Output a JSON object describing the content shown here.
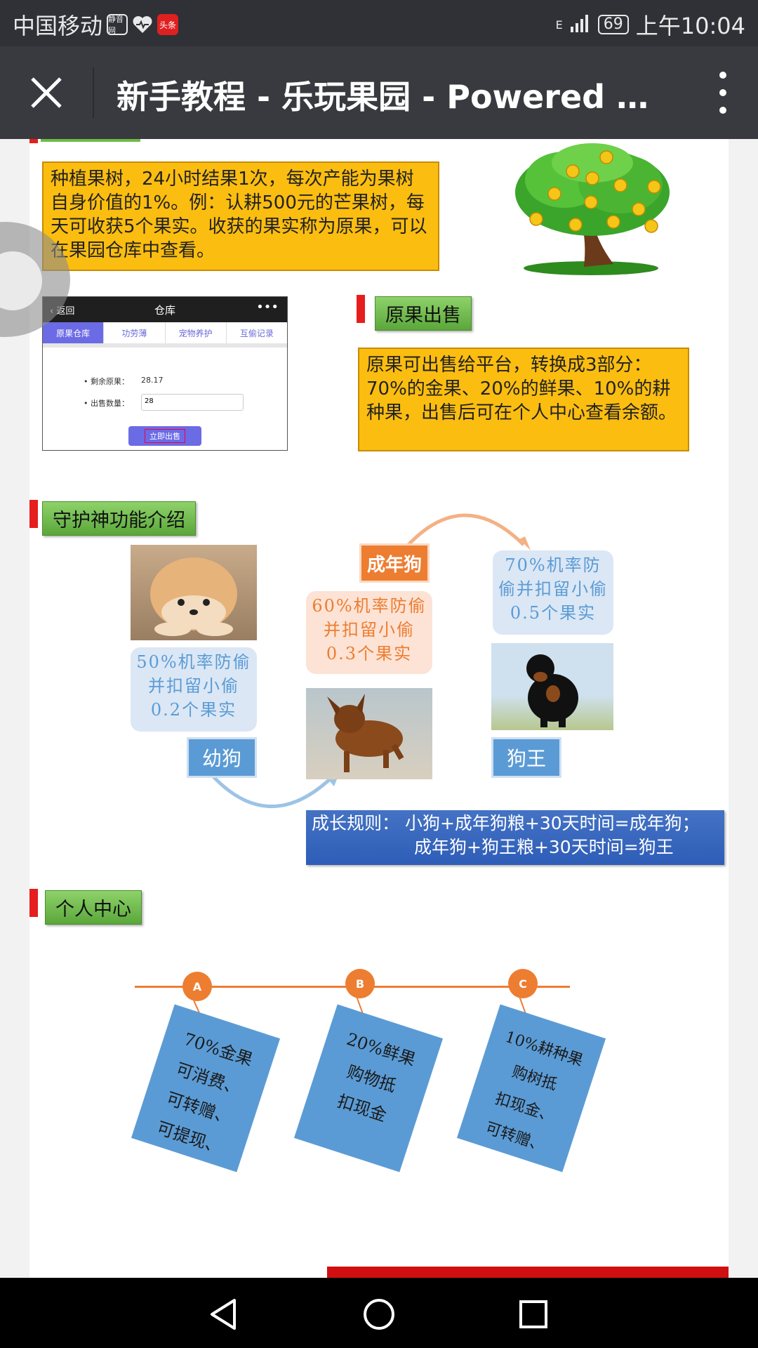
{
  "status_bar": {
    "carrier": "中国移动",
    "app_icon_1": "静音网",
    "app_icon_3": "头条",
    "network": "E",
    "battery": "69",
    "time": "上午10:04"
  },
  "titlebar": {
    "title": "新手教程 - 乐玩果园 - Powered by..."
  },
  "section_harvest": {
    "text": "种植果树，24小时结果1次，每次产能为果树自身价值的1%。例：认耕500元的芒果树，每天可收获5个果实。收获的果实称为原果，可以在果园仓库中查看。"
  },
  "warehouse_screenshot": {
    "back": "返回",
    "title": "仓库",
    "dots": "•••",
    "tabs": [
      "原果仓库",
      "功劳薄",
      "宠物养护",
      "互偷记录"
    ],
    "remaining_label": "• 剩余原果：",
    "remaining_value": "28.17",
    "sell_label": "• 出售数量：",
    "sell_value": "28",
    "sell_button": "立即出售"
  },
  "section_sell": {
    "tag": "原果出售",
    "text": "原果可出售给平台，转换成3部分：70%的金果、20%的鲜果、10%的耕种果，出售后可在个人中心查看余额。"
  },
  "section_guardian": {
    "tag": "守护神功能介绍",
    "puppy_bubble": "50%机率防偷并扣留小偷0.2个果实",
    "puppy_label": "幼狗",
    "adult_label": "成年狗",
    "adult_bubble": "60%机率防偷并扣留小偷0.3个果实",
    "king_bubble": "70%机率防偷并扣留小偷0.5个果实",
    "king_label": "狗王",
    "rule_line1": "成长规则： 小狗+成年狗粮+30天时间=成年狗；",
    "rule_line2": "成年狗+狗王粮+30天时间=狗王"
  },
  "section_personal": {
    "tag": "个人中心",
    "cards": [
      {
        "letter": "A",
        "lines": [
          "70%金果",
          "可消费、",
          "可转赠、",
          "可提现、"
        ]
      },
      {
        "letter": "B",
        "lines": [
          "20%鲜果",
          "购物抵",
          "扣现金"
        ]
      },
      {
        "letter": "C",
        "lines": [
          "10%耕种果",
          "购树抵",
          "扣现金、",
          "可转赠、"
        ]
      }
    ]
  },
  "colors": {
    "tag_bar": "#e61e1e",
    "tag_green": "#6cbb46",
    "orange_box": "#fbbd10",
    "blue": "#5b9bd5",
    "orange": "#ed7d31",
    "titlebar": "#393a3f"
  },
  "icons": [
    "close-icon",
    "more-icon",
    "back-icon",
    "home-icon",
    "recents-icon",
    "signal-icon",
    "heart-icon"
  ]
}
